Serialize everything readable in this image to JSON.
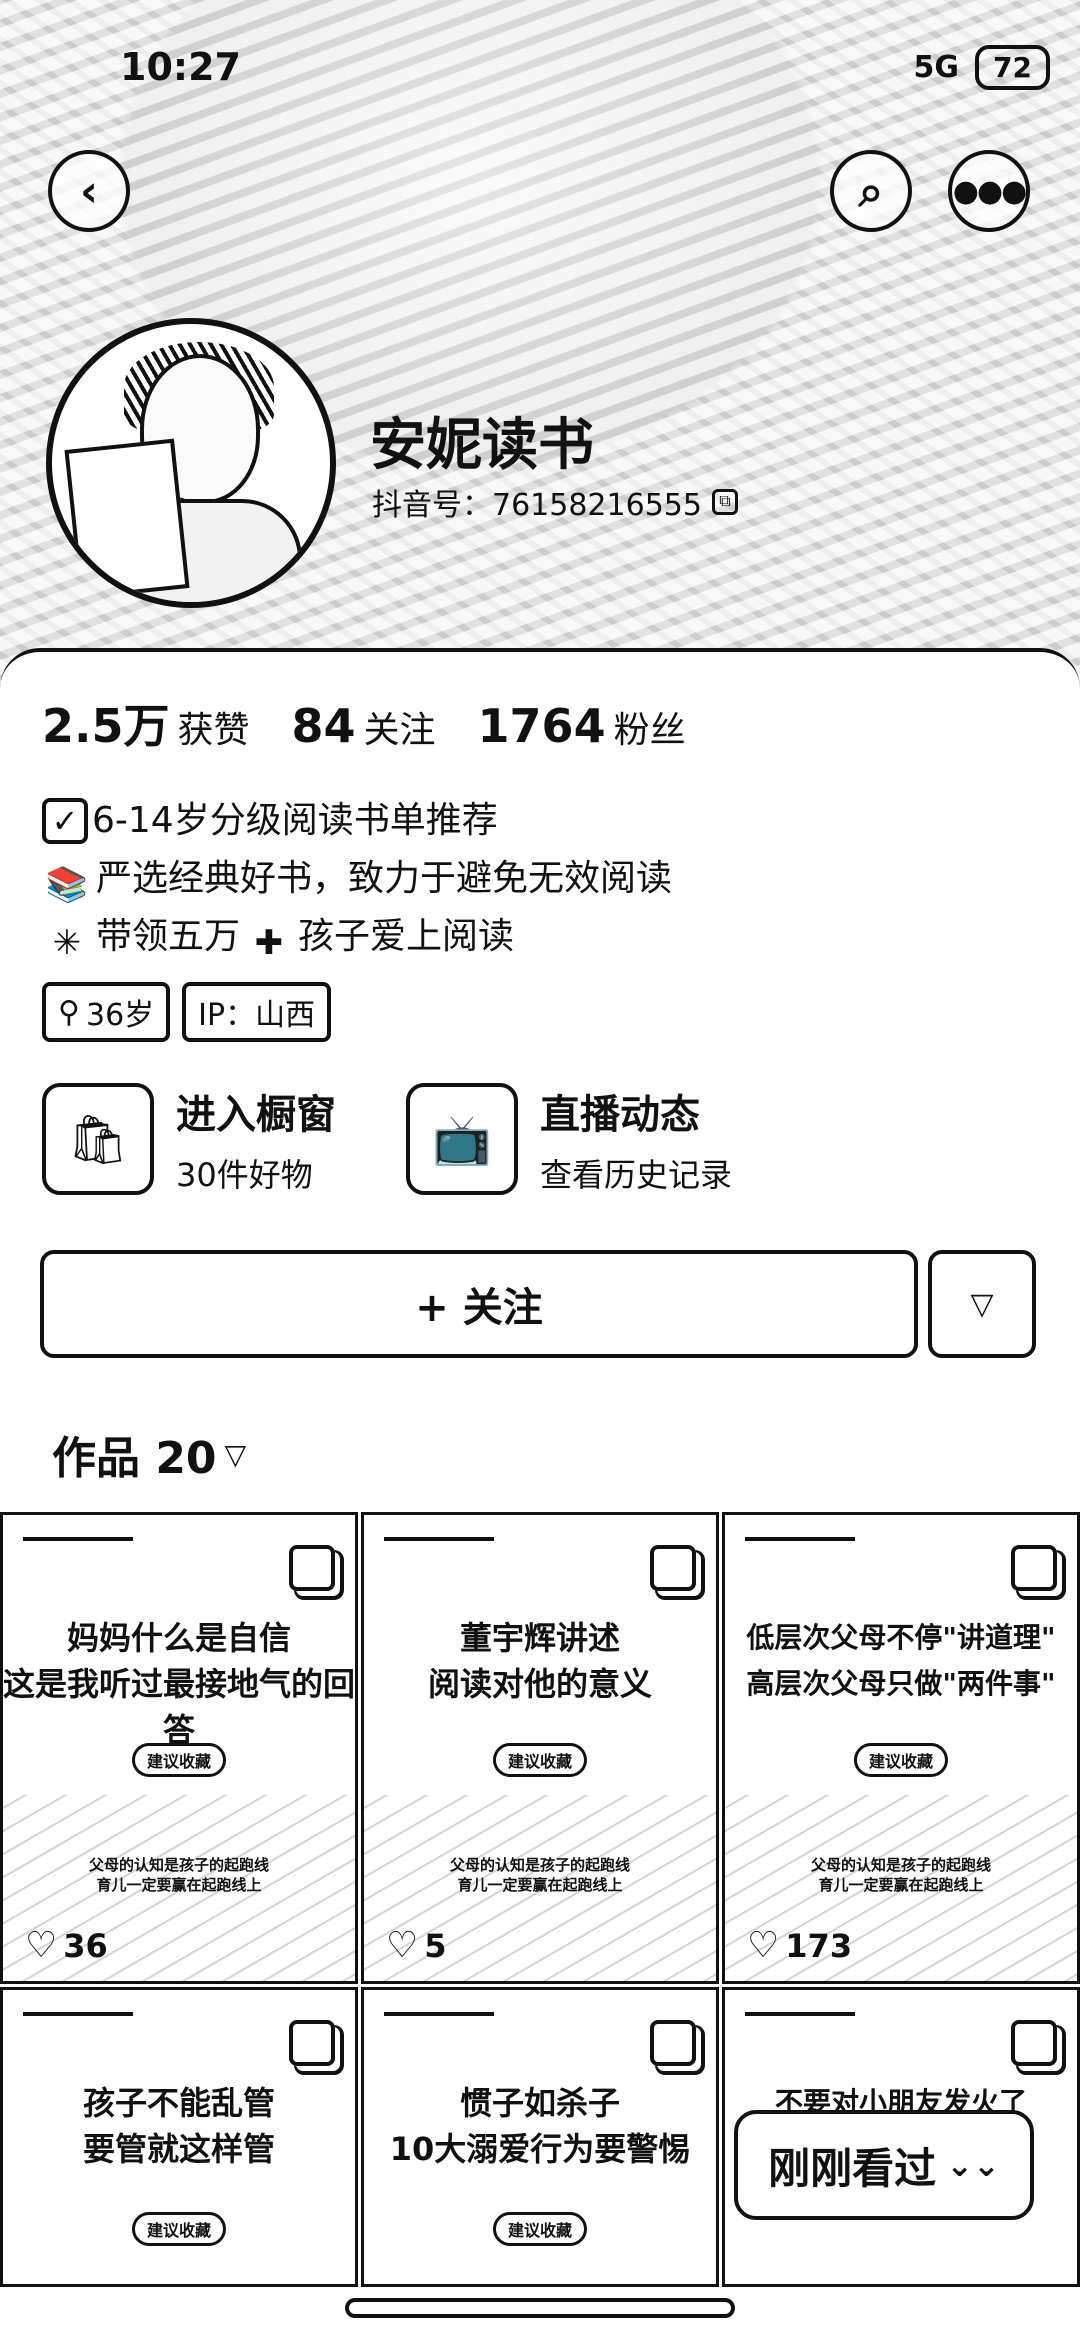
{
  "status_bar": {
    "time": "10:27",
    "signal": "5G",
    "battery": "72"
  },
  "header": {
    "back_icon": "chevron-left-icon",
    "search_icon": "search-icon",
    "more_icon": "more-icon",
    "nickname": "安妮读书",
    "douyin_id": "抖音号：76158216555"
  },
  "stats": [
    {
      "num": "2.5万",
      "label": "获赞"
    },
    {
      "num": "84",
      "label": "关注"
    },
    {
      "num": "1764",
      "label": "粉丝"
    }
  ],
  "bio": {
    "line1": "6-14岁分级阅读书单推荐",
    "line2": "严选经典好书，致力于避免无效阅读",
    "line3_a": "带领五万",
    "line3_b": "孩子爱上阅读"
  },
  "tags": {
    "age": "36岁",
    "ip": "IP：山西"
  },
  "entries": {
    "shop_title": "进入橱窗",
    "shop_sub": "30件好物",
    "live_title": "直播动态",
    "live_sub": "查看历史记录"
  },
  "follow_label": "+ 关注",
  "works_label": "作品 20",
  "works": [
    {
      "title1": "妈妈什么是自信",
      "title2": "这是我听过最接地气的回答",
      "tag": "建议收藏",
      "cap1": "父母的认知是孩子的起跑线",
      "cap2": "育儿一定要赢在起跑线上",
      "likes": "36"
    },
    {
      "title1": "董宇辉讲述",
      "title2": "阅读对他的意义",
      "tag": "建议收藏",
      "cap1": "父母的认知是孩子的起跑线",
      "cap2": "育儿一定要赢在起跑线上",
      "likes": "5"
    },
    {
      "title1": "低层次父母不停\"讲道理\"",
      "title2": "高层次父母只做\"两件事\"",
      "tag": "建议收藏",
      "cap1": "父母的认知是孩子的起跑线",
      "cap2": "育儿一定要赢在起跑线上",
      "likes": "173"
    },
    {
      "title1": "孩子不能乱管",
      "title2": "要管就这样管",
      "tag": "建议收藏"
    },
    {
      "title1": "惯子如杀子",
      "title2": "10大溺爱行为要警惕",
      "tag": "建议收藏"
    },
    {
      "title1": "不要对小朋友发火了",
      "title2": ""
    }
  ],
  "just_viewed": "刚刚看过"
}
